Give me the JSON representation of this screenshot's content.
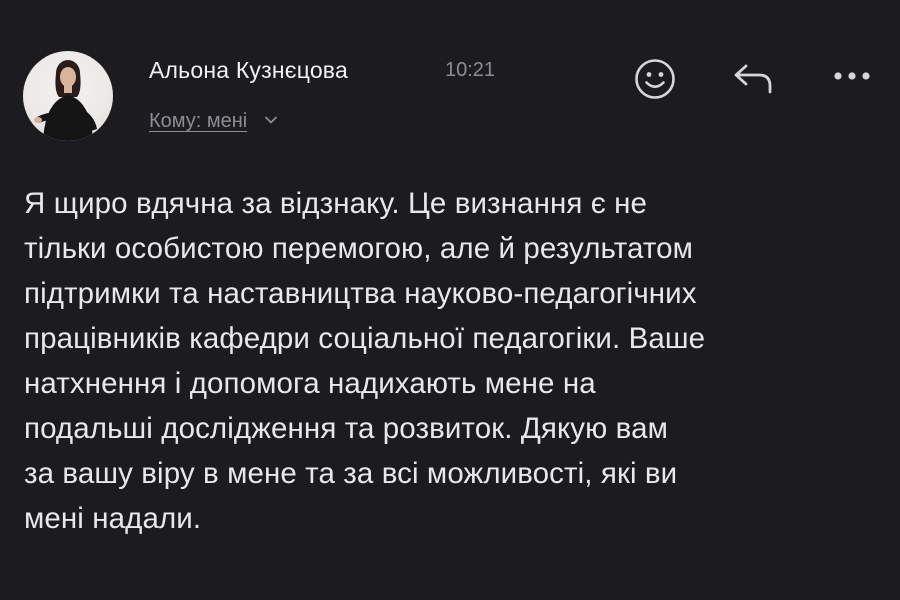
{
  "message": {
    "sender_name": "Альона Кузнєцова",
    "time": "10:21",
    "recipients_label": "Кому: мені",
    "body_lines": [
      "Я щиро вдячна за відзнаку. Це визнання є не",
      "тільки особистою перемогою, але й результатом",
      "підтримки та наставництва науково-педагогічних",
      "працівників кафедри соціальної педагогіки. Ваше",
      "натхнення і допомога надихають мене на",
      "подальші дослідження та розвиток. Дякую вам",
      "за вашу віру в мене та за всі можливості, які ви",
      "мені надали."
    ]
  },
  "actions": [
    {
      "icon": "emoji-reaction-icon"
    },
    {
      "icon": "reply-arrow-icon"
    },
    {
      "icon": "more-dots-icon"
    }
  ],
  "colors": {
    "background": "#1c1b20",
    "primary_text": "#e8e8ea",
    "secondary_text": "#8c8c93"
  }
}
